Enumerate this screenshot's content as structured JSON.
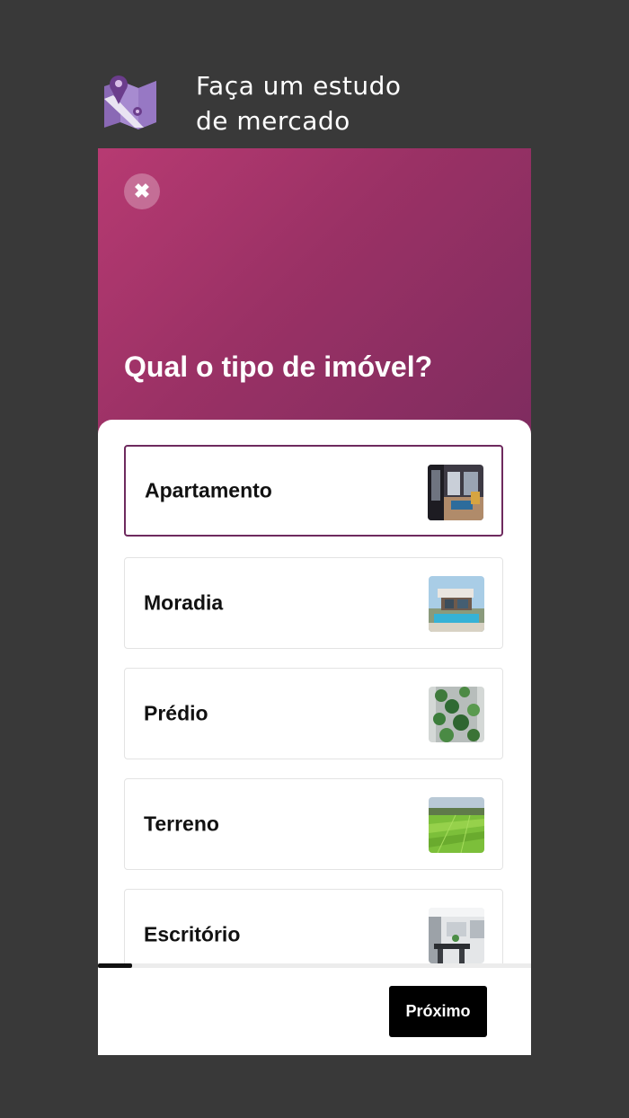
{
  "header": {
    "icon": "map-pin-icon",
    "title_line1": "Faça um estudo",
    "title_line2": "de mercado"
  },
  "modal": {
    "close_icon": "close-icon",
    "close_symbol": "✖",
    "question": "Qual o tipo de imóvel?",
    "gradient_colors": [
      "#b73a72",
      "#7e2c5f"
    ],
    "selected_border_color": "#6e2a5e",
    "options": [
      {
        "label": "Apartamento",
        "thumbnail": "apartment-interior-image",
        "selected": true
      },
      {
        "label": "Moradia",
        "thumbnail": "modern-house-pool-image",
        "selected": false
      },
      {
        "label": "Prédio",
        "thumbnail": "green-building-image",
        "selected": false
      },
      {
        "label": "Terreno",
        "thumbnail": "green-fields-image",
        "selected": false
      },
      {
        "label": "Escritório",
        "thumbnail": "office-interior-image",
        "selected": false
      }
    ],
    "scroll_progress": 0.08,
    "next_button": "Próximo"
  }
}
